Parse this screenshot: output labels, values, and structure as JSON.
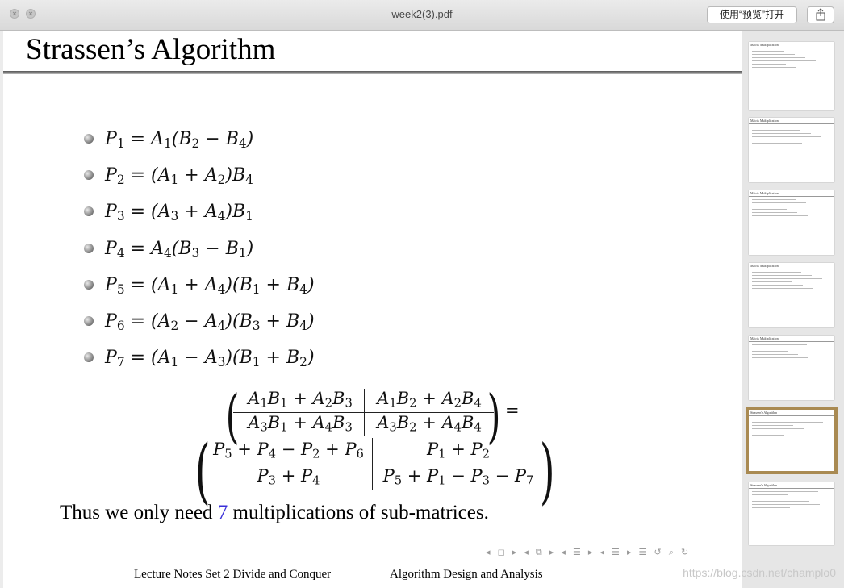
{
  "window": {
    "title": "week2(3).pdf",
    "open_with_label": "使用“预览”打开"
  },
  "slide": {
    "title": "Strassen’s Algorithm",
    "equations": [
      {
        "lhs": "P",
        "lhs_sub": "1",
        "rhs_html": "A<sub>1</sub>(B<sub>2</sub> − B<sub>4</sub>)"
      },
      {
        "lhs": "P",
        "lhs_sub": "2",
        "rhs_html": "(A<sub>1</sub> + A<sub>2</sub>)B<sub>4</sub>"
      },
      {
        "lhs": "P",
        "lhs_sub": "3",
        "rhs_html": "(A<sub>3</sub> + A<sub>4</sub>)B<sub>1</sub>"
      },
      {
        "lhs": "P",
        "lhs_sub": "4",
        "rhs_html": "A<sub>4</sub>(B<sub>3</sub> − B<sub>1</sub>)"
      },
      {
        "lhs": "P",
        "lhs_sub": "5",
        "rhs_html": "(A<sub>1</sub> + A<sub>4</sub>)(B<sub>1</sub> + B<sub>4</sub>)"
      },
      {
        "lhs": "P",
        "lhs_sub": "6",
        "rhs_html": "(A<sub>2</sub> − A<sub>4</sub>)(B<sub>3</sub> + B<sub>4</sub>)"
      },
      {
        "lhs": "P",
        "lhs_sub": "7",
        "rhs_html": "(A<sub>1</sub> − A<sub>3</sub>)(B<sub>1</sub> + B<sub>2</sub>)"
      }
    ],
    "matrix_top": {
      "c11": "A<sub>1</sub>B<sub>1</sub> + A<sub>2</sub>B<sub>3</sub>",
      "c12": "A<sub>1</sub>B<sub>2</sub> + A<sub>2</sub>B<sub>4</sub>",
      "c21": "A<sub>3</sub>B<sub>1</sub> + A<sub>4</sub>B<sub>3</sub>",
      "c22": "A<sub>3</sub>B<sub>2</sub> + A<sub>4</sub>B<sub>4</sub>"
    },
    "equals": "=",
    "matrix_bottom": {
      "c11": "P<sub>5</sub> + P<sub>4</sub> − P<sub>2</sub> + P<sub>6</sub>",
      "c12": "P<sub>1</sub> + P<sub>2</sub>",
      "c21": "P<sub>3</sub> + P<sub>4</sub>",
      "c22": "P<sub>5</sub> + P<sub>1</sub> − P<sub>3</sub> − P<sub>7</sub>"
    },
    "conclusion_before": "Thus we only need ",
    "conclusion_number": "7",
    "conclusion_after": " multiplications of sub-matrices.",
    "footer_left": "Lecture Notes Set 2  Divide and Conquer",
    "footer_right": "Algorithm Design and Analysis",
    "nav_symbols": "◂ ◻ ▸ ◂ ⧉ ▸ ◂ ☰ ▸ ◂ ☰ ▸ ☰ ↺ ⌕ ↻"
  },
  "sidebar": {
    "thumbnails": [
      {
        "title": "Matrix Multiplication"
      },
      {
        "title": "Matrix Multiplication"
      },
      {
        "title": "Matrix Multiplication"
      },
      {
        "title": "Matrix Multiplication"
      },
      {
        "title": "Matrix Multiplication"
      },
      {
        "title": "Strassen's Algorithm",
        "selected": true
      },
      {
        "title": "Strassen's Algorithm"
      }
    ]
  },
  "watermark": "https://blog.csdn.net/champlo0",
  "colors": {
    "highlight_number": "#3a2fd8",
    "selected_thumb_border": "#a98a52"
  }
}
